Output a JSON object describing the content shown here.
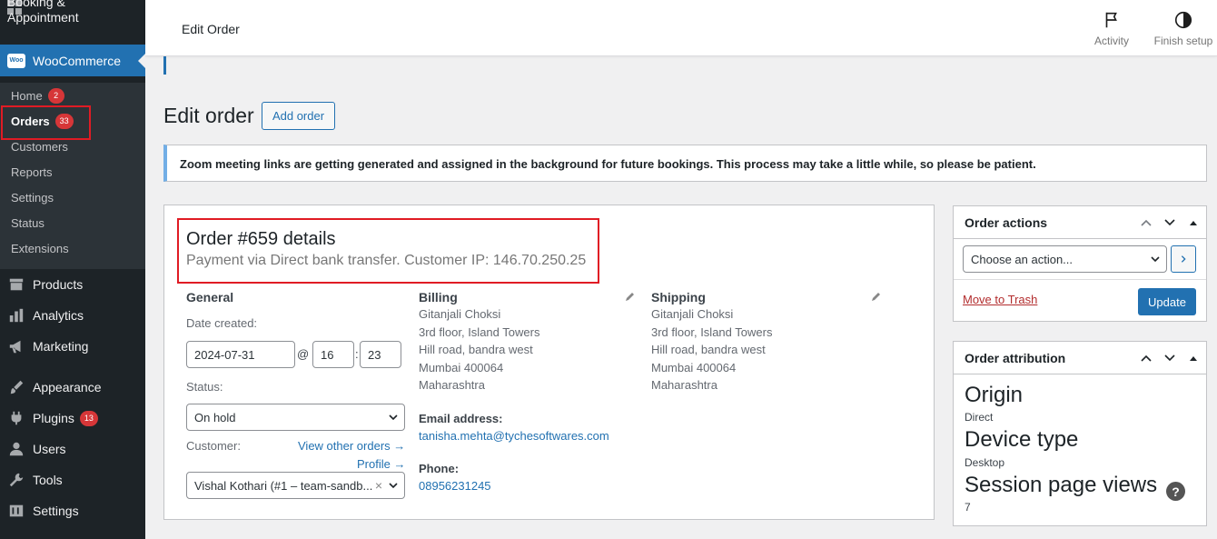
{
  "sidebar": {
    "booking_label_1": "Booking &",
    "booking_label_2": "Appointment",
    "woocommerce": "WooCommerce",
    "woo_logo": "Woo",
    "submenu": [
      {
        "label": "Home",
        "badge": "2"
      },
      {
        "label": "Orders",
        "badge": "33"
      },
      {
        "label": "Customers"
      },
      {
        "label": "Reports"
      },
      {
        "label": "Settings"
      },
      {
        "label": "Status"
      },
      {
        "label": "Extensions"
      }
    ],
    "menu": [
      {
        "label": "Products",
        "icon": "archive-icon"
      },
      {
        "label": "Analytics",
        "icon": "bar-chart-icon"
      },
      {
        "label": "Marketing",
        "icon": "megaphone-icon"
      },
      {
        "label": "Appearance",
        "icon": "brush-icon"
      },
      {
        "label": "Plugins",
        "icon": "plug-icon",
        "badge": "13"
      },
      {
        "label": "Users",
        "icon": "user-icon"
      },
      {
        "label": "Tools",
        "icon": "wrench-icon"
      },
      {
        "label": "Settings",
        "icon": "sliders-icon"
      }
    ]
  },
  "topbar": {
    "title": "Edit Order",
    "activity": "Activity",
    "finish_setup": "Finish setup"
  },
  "page": {
    "heading": "Edit order",
    "add_order": "Add order",
    "notice": "Zoom meeting links are getting generated and assigned in the background for future bookings. This process may take a little while, so please be patient."
  },
  "order": {
    "title": "Order #659 details",
    "subtitle": "Payment via Direct bank transfer. Customer IP: 146.70.250.25",
    "general": {
      "heading": "General",
      "date_label": "Date created:",
      "date": "2024-07-31",
      "at": "@",
      "hour": "16",
      "colon": ":",
      "minute": "23",
      "status_label": "Status:",
      "status": "On hold",
      "customer_label": "Customer:",
      "view_other_orders": "View other orders →",
      "profile": "Profile →",
      "customer": "Vishal Kothari (#1 – team-sandb...",
      "clear": "×"
    },
    "billing": {
      "heading": "Billing",
      "lines": [
        "Gitanjali Choksi",
        "3rd floor, Island Towers",
        "Hill road, bandra west",
        "Mumbai 400064",
        "Maharashtra"
      ],
      "email_label": "Email address:",
      "email": "tanisha.mehta@tychesoftwares.com",
      "phone_label": "Phone:",
      "phone": "08956231245"
    },
    "shipping": {
      "heading": "Shipping",
      "lines": [
        "Gitanjali Choksi",
        "3rd floor, Island Towers",
        "Hill road, bandra west",
        "Mumbai 400064",
        "Maharashtra"
      ]
    }
  },
  "order_actions": {
    "heading": "Order actions",
    "choose": "Choose an action...",
    "trash": "Move to Trash",
    "update": "Update"
  },
  "attribution": {
    "heading": "Order attribution",
    "origin_label": "Origin",
    "origin": "Direct",
    "device_label": "Device type",
    "device": "Desktop",
    "views_label": "Session page views",
    "views": "7",
    "help": "?"
  },
  "colors": {
    "accent": "#2271b1",
    "sidebar": "#1d2327",
    "highlight": "#e01b24",
    "badge": "#d63638"
  }
}
